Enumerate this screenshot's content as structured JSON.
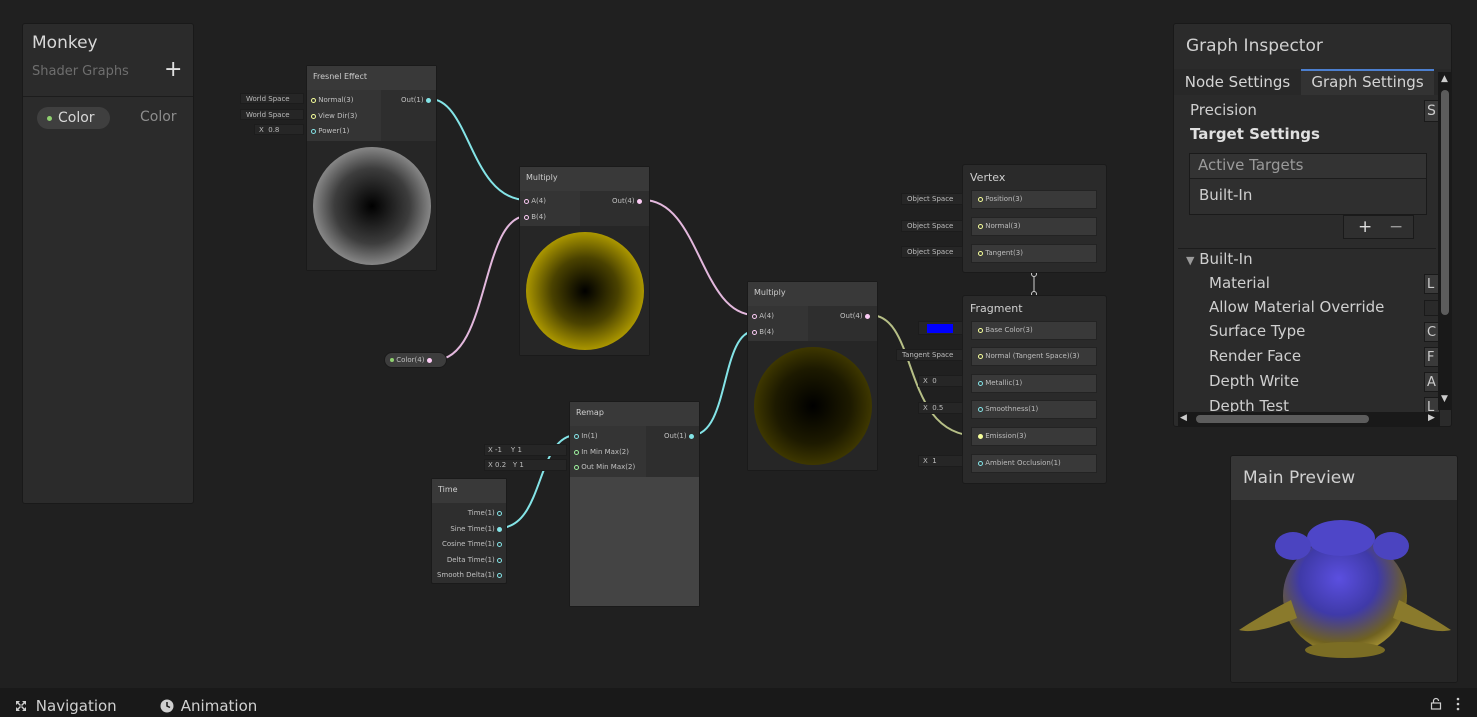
{
  "blackboard": {
    "title": "Monkey",
    "subtitle": "Shader Graphs",
    "add_icon": "+",
    "property_name": "Color",
    "property_type": "Color"
  },
  "nodes": {
    "fresnel": {
      "title": "Fresnel Effect",
      "inputs": [
        "Normal(3)",
        "View Dir(3)",
        "Power(1)"
      ],
      "output": "Out(1)",
      "normal_value": "World Space",
      "viewdir_value": "World Space",
      "power_axis": "X",
      "power_value": "0.8"
    },
    "multiply1": {
      "title": "Multiply",
      "inputs": [
        "A(4)",
        "B(4)"
      ],
      "output": "Out(4)"
    },
    "multiply2": {
      "title": "Multiply",
      "inputs": [
        "A(4)",
        "B(4)"
      ],
      "output": "Out(4)"
    },
    "color_property": {
      "label": "Color(4)"
    },
    "remap": {
      "title": "Remap",
      "inputs": [
        "In(1)",
        "In Min Max(2)",
        "Out Min Max(2)"
      ],
      "output": "Out(1)",
      "in_min_max": {
        "x_label": "X",
        "x": "-1",
        "y_label": "Y",
        "y": "1"
      },
      "out_min_max": {
        "x_label": "X",
        "x": "0.2",
        "y_label": "Y",
        "y": "1"
      }
    },
    "time": {
      "title": "Time",
      "outputs": [
        "Time(1)",
        "Sine Time(1)",
        "Cosine Time(1)",
        "Delta Time(1)",
        "Smooth Delta(1)"
      ]
    }
  },
  "master": {
    "vertex_title": "Vertex",
    "vertex_slots": [
      "Position(3)",
      "Normal(3)",
      "Tangent(3)"
    ],
    "vertex_values": [
      "Object Space",
      "Object Space",
      "Object Space"
    ],
    "fragment_title": "Fragment",
    "fragment_slots": [
      "Base Color(3)",
      "Normal (Tangent Space)(3)",
      "Metallic(1)",
      "Smoothness(1)",
      "Emission(3)",
      "Ambient Occlusion(1)"
    ],
    "normal_value": "Tangent Space",
    "metallic": {
      "axis": "X",
      "value": "0"
    },
    "smoothness": {
      "axis": "X",
      "value": "0.5"
    },
    "ambient_occlusion": {
      "axis": "X",
      "value": "1"
    },
    "base_color": "#0000ff"
  },
  "inspector": {
    "title": "Graph Inspector",
    "tabs": [
      "Node Settings",
      "Graph Settings"
    ],
    "precision_label": "Precision",
    "precision_value": "S",
    "target_settings_label": "Target Settings",
    "active_targets_label": "Active Targets",
    "targets": [
      "Built-In"
    ],
    "add_icon": "+",
    "remove_icon": "−",
    "section_label": "Built-In",
    "properties": [
      {
        "label": "Material",
        "value": "L"
      },
      {
        "label": "Allow Material Override",
        "value": ""
      },
      {
        "label": "Surface Type",
        "value": "C"
      },
      {
        "label": "Render Face",
        "value": "F"
      },
      {
        "label": "Depth Write",
        "value": "A"
      },
      {
        "label": "Depth Test",
        "value": "L"
      }
    ]
  },
  "main_preview": {
    "title": "Main Preview"
  },
  "bottom_bar": {
    "navigation_label": "Navigation",
    "animation_label": "Animation"
  },
  "colors": {
    "wire_float": "#84e4e7",
    "wire_vector4": "#fbcbf4",
    "wire_vector3": "#f6ff9a",
    "base_color": "#0000ff",
    "accent_blue": "#4c7fcf"
  }
}
